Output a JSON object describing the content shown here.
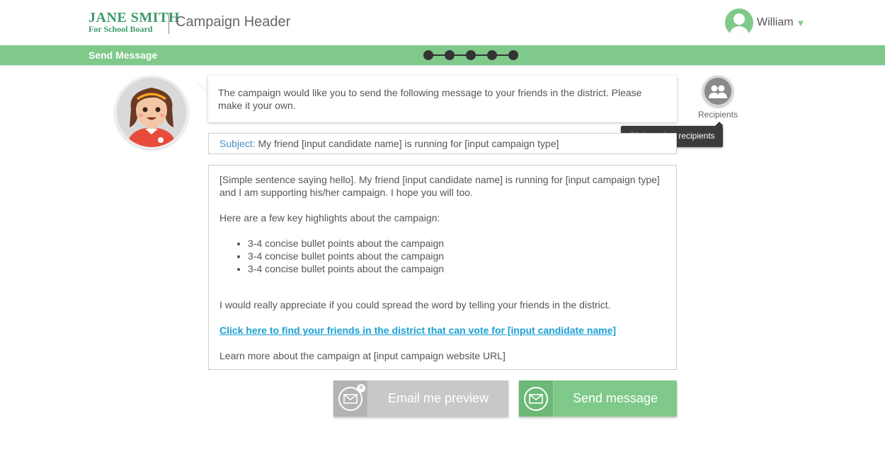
{
  "header": {
    "logo_line1": "JANE SMITH",
    "logo_line2": "For School Board",
    "campaign_title": "Campaign Header",
    "user_name": "William",
    "user_caret": "▼"
  },
  "toolbar": {
    "title": "Send Message",
    "steps_count": 5
  },
  "intro": {
    "message": "The campaign would like you to send the following message to your friends in the district. Please make it your own."
  },
  "recipients": {
    "label": "Recipients",
    "tooltip": "Click to view recipients",
    "icon": "users-icon"
  },
  "subject": {
    "label": "Subject:",
    "value": " My friend [input candidate name] is running for [input campaign type]"
  },
  "body": {
    "intro_line": "[Simple sentence saying hello].  My friend [input candidate name] is running for [input campaign type] and I am supporting his/her campaign. I hope you will too.",
    "highlights_heading": "Here are a few key highlights about the campaign:",
    "bullets": [
      "3-4 concise bullet points about the campaign",
      "3-4 concise bullet points about the campaign",
      "3-4 concise bullet points about the campaign"
    ],
    "appreciate": "I would really appreciate if you could spread the word by telling your friends in the district.",
    "link_text": "Click here to find your friends in the district that can vote for [input candidate name]",
    "learn_more": "Learn more about the campaign at [input campaign website URL]"
  },
  "buttons": {
    "preview_label": "Email me preview",
    "send_label": "Send message"
  },
  "colors": {
    "brand_green": "#7fc98a",
    "logo_green": "#3c9a6a",
    "link_blue": "#1aa0d6",
    "subject_label_blue": "#4a90c2"
  }
}
